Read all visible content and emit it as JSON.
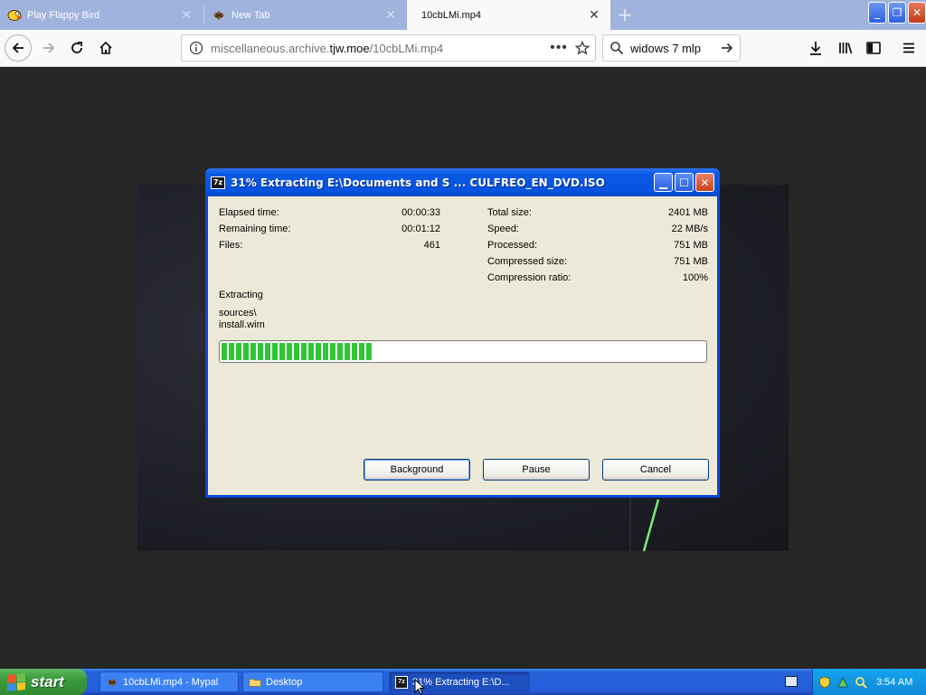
{
  "browser": {
    "tabs": [
      {
        "label": "Play Flappy Bird",
        "icon": "flappy-bird-icon",
        "active": false
      },
      {
        "label": "New Tab",
        "icon": "mypal-icon",
        "active": false
      },
      {
        "label": "10cbLMi.mp4",
        "icon": "",
        "active": true
      }
    ],
    "url": {
      "prefix": "miscellaneous.archive.",
      "domain": "tjw.moe",
      "path": "/10cbLMi.mp4"
    },
    "search_value": "widows 7 mlp"
  },
  "dialog": {
    "title": "31% Extracting E:\\Documents and S ... CULFREO_EN_DVD.ISO",
    "app_icon_text": "7z",
    "left_stats": [
      {
        "label": "Elapsed time:",
        "value": "00:00:33"
      },
      {
        "label": "Remaining time:",
        "value": "00:01:12"
      },
      {
        "label": "Files:",
        "value": "461"
      }
    ],
    "right_stats": [
      {
        "label": "Total size:",
        "value": "2401 MB"
      },
      {
        "label": "Speed:",
        "value": "22 MB/s"
      },
      {
        "label": "Processed:",
        "value": "751 MB"
      },
      {
        "label": "Compressed size:",
        "value": "751 MB"
      },
      {
        "label": "Compression ratio:",
        "value": "100%"
      }
    ],
    "status": "Extracting",
    "path_line1": "sources\\",
    "path_line2": "install.wim",
    "progress_percent": 31,
    "buttons": {
      "background": "Background",
      "pause": "Pause",
      "cancel": "Cancel"
    }
  },
  "taskbar": {
    "start_label": "start",
    "tasks": [
      {
        "label": "10cbLMi.mp4 - Mypal",
        "icon": "mypal-icon"
      },
      {
        "label": "Desktop",
        "icon": "folder-icon"
      },
      {
        "label": "31% Extracting E:\\D...",
        "icon": "7zip-icon"
      }
    ],
    "clock": "3:54 AM"
  },
  "colors": {
    "xp_blue": "#0a46d8",
    "taskbar_blue": "#245edb",
    "start_green": "#3c9a3c",
    "progress_green": "#2fc636",
    "dialog_face": "#ece9d8"
  }
}
